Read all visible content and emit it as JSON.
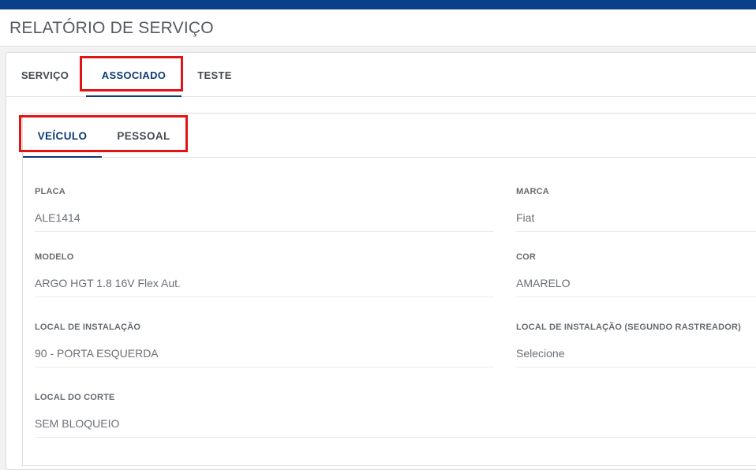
{
  "page": {
    "title": "RELATÓRIO DE SERVIÇO"
  },
  "main_tabs": [
    {
      "label": "SERVIÇO",
      "active": false
    },
    {
      "label": "ASSOCIADO",
      "active": true
    },
    {
      "label": "TESTE",
      "active": false
    }
  ],
  "sub_tabs": [
    {
      "label": "VEÍCULO",
      "active": true
    },
    {
      "label": "PESSOAL",
      "active": false
    }
  ],
  "fields": {
    "placa": {
      "label": "PLACA",
      "value": "ALE1414"
    },
    "marca": {
      "label": "MARCA",
      "value": "Fiat"
    },
    "modelo": {
      "label": "MODELO",
      "value": "ARGO HGT 1.8 16V Flex Aut."
    },
    "cor": {
      "label": "COR",
      "value": "AMARELO"
    },
    "local_instalacao": {
      "label": "LOCAL DE INSTALAÇÃO",
      "value": "90 - PORTA ESQUERDA"
    },
    "local_instalacao_rastreador": {
      "label": "LOCAL DE INSTALAÇÃO (SEGUNDO RASTREADOR)",
      "value": "Selecione"
    },
    "local_corte": {
      "label": "LOCAL DO CORTE",
      "value": "SEM BLOQUEIO"
    }
  },
  "colors": {
    "brand_blue": "#0b3f8a",
    "active_tab": "#0d3a78",
    "highlight_red": "#e01414"
  }
}
